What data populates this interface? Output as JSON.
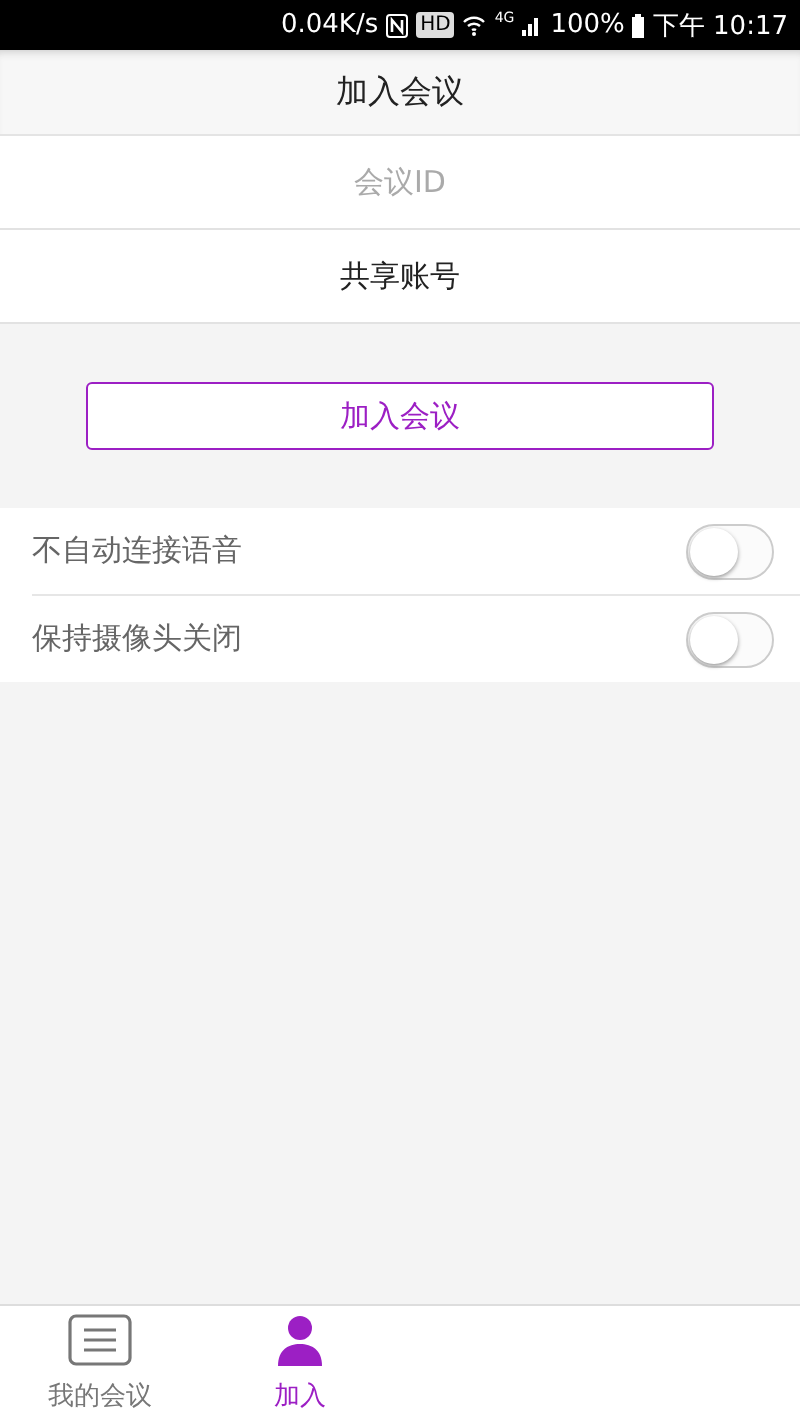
{
  "status_bar": {
    "speed": "0.04K/s",
    "hd": "HD",
    "network": "4G",
    "battery": "100%",
    "time": "下午 10:17"
  },
  "header": {
    "title": "加入会议"
  },
  "fields": [
    {
      "placeholder": "会议ID"
    },
    {
      "value": "共享账号"
    }
  ],
  "join_button": "加入会议",
  "options": [
    {
      "label": "不自动连接语音",
      "on": false
    },
    {
      "label": "保持摄像头关闭",
      "on": false
    }
  ],
  "tabs": [
    {
      "label": "我的会议",
      "selected": false,
      "kind": "list"
    },
    {
      "label": "加入",
      "selected": true,
      "kind": "person"
    }
  ]
}
